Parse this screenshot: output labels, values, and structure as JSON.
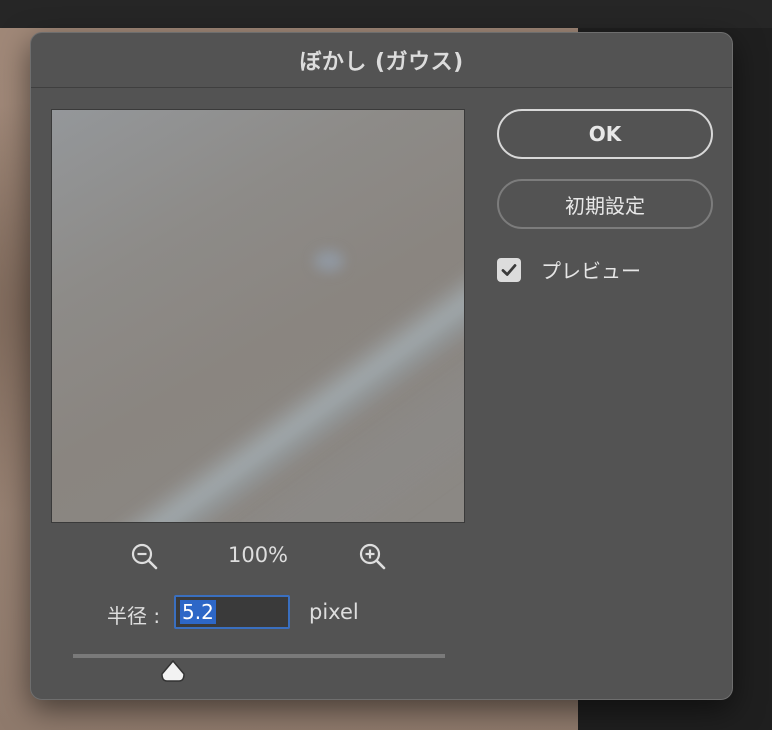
{
  "dialog": {
    "title": "ぼかし (ガウス)"
  },
  "buttons": {
    "ok_label": "OK",
    "reset_label": "初期設定"
  },
  "preview_toggle": {
    "label": "プレビュー",
    "checked": true
  },
  "zoom": {
    "level": "100%",
    "zoom_out_icon": "zoom-out-icon",
    "zoom_in_icon": "zoom-in-icon"
  },
  "radius": {
    "label": "半径 :",
    "value": "5.2",
    "unit": "pixel",
    "slider_fraction": 0.27
  },
  "colors": {
    "dialog_bg": "#535353",
    "input_focus": "#3a6fbf",
    "selection": "#2d67c7"
  }
}
